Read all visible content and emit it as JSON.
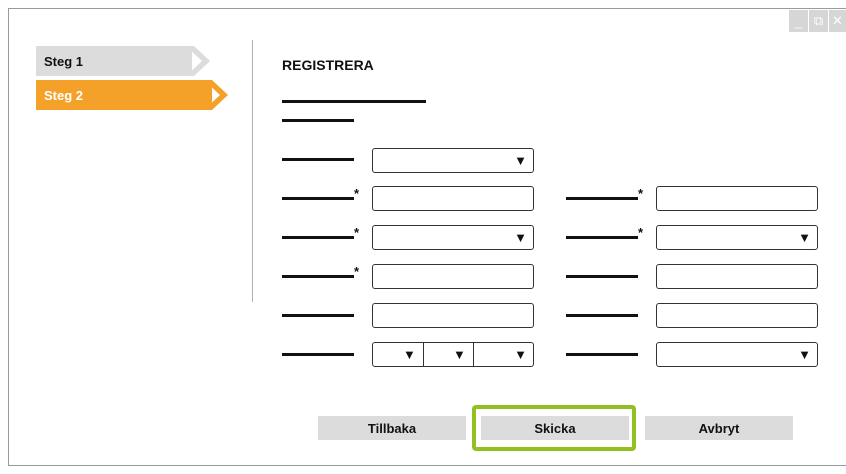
{
  "window": {
    "controls": [
      {
        "icon": "minimize-icon",
        "glyph": "_"
      },
      {
        "icon": "restore-icon",
        "glyph": "⧉"
      },
      {
        "icon": "close-icon",
        "glyph": "✕"
      }
    ]
  },
  "steps": [
    {
      "label": "Steg 1",
      "active": false
    },
    {
      "label": "Steg 2",
      "active": true
    }
  ],
  "form": {
    "title": "REGISTRERA",
    "required_marker": "*",
    "dropdown_glyph": "▼"
  },
  "buttons": {
    "back": "Tillbaka",
    "submit": "Skicka",
    "cancel": "Avbryt"
  },
  "colors": {
    "active_step": "#f4a12a",
    "inactive_step": "#dcdcdc",
    "highlight": "#92c020"
  }
}
